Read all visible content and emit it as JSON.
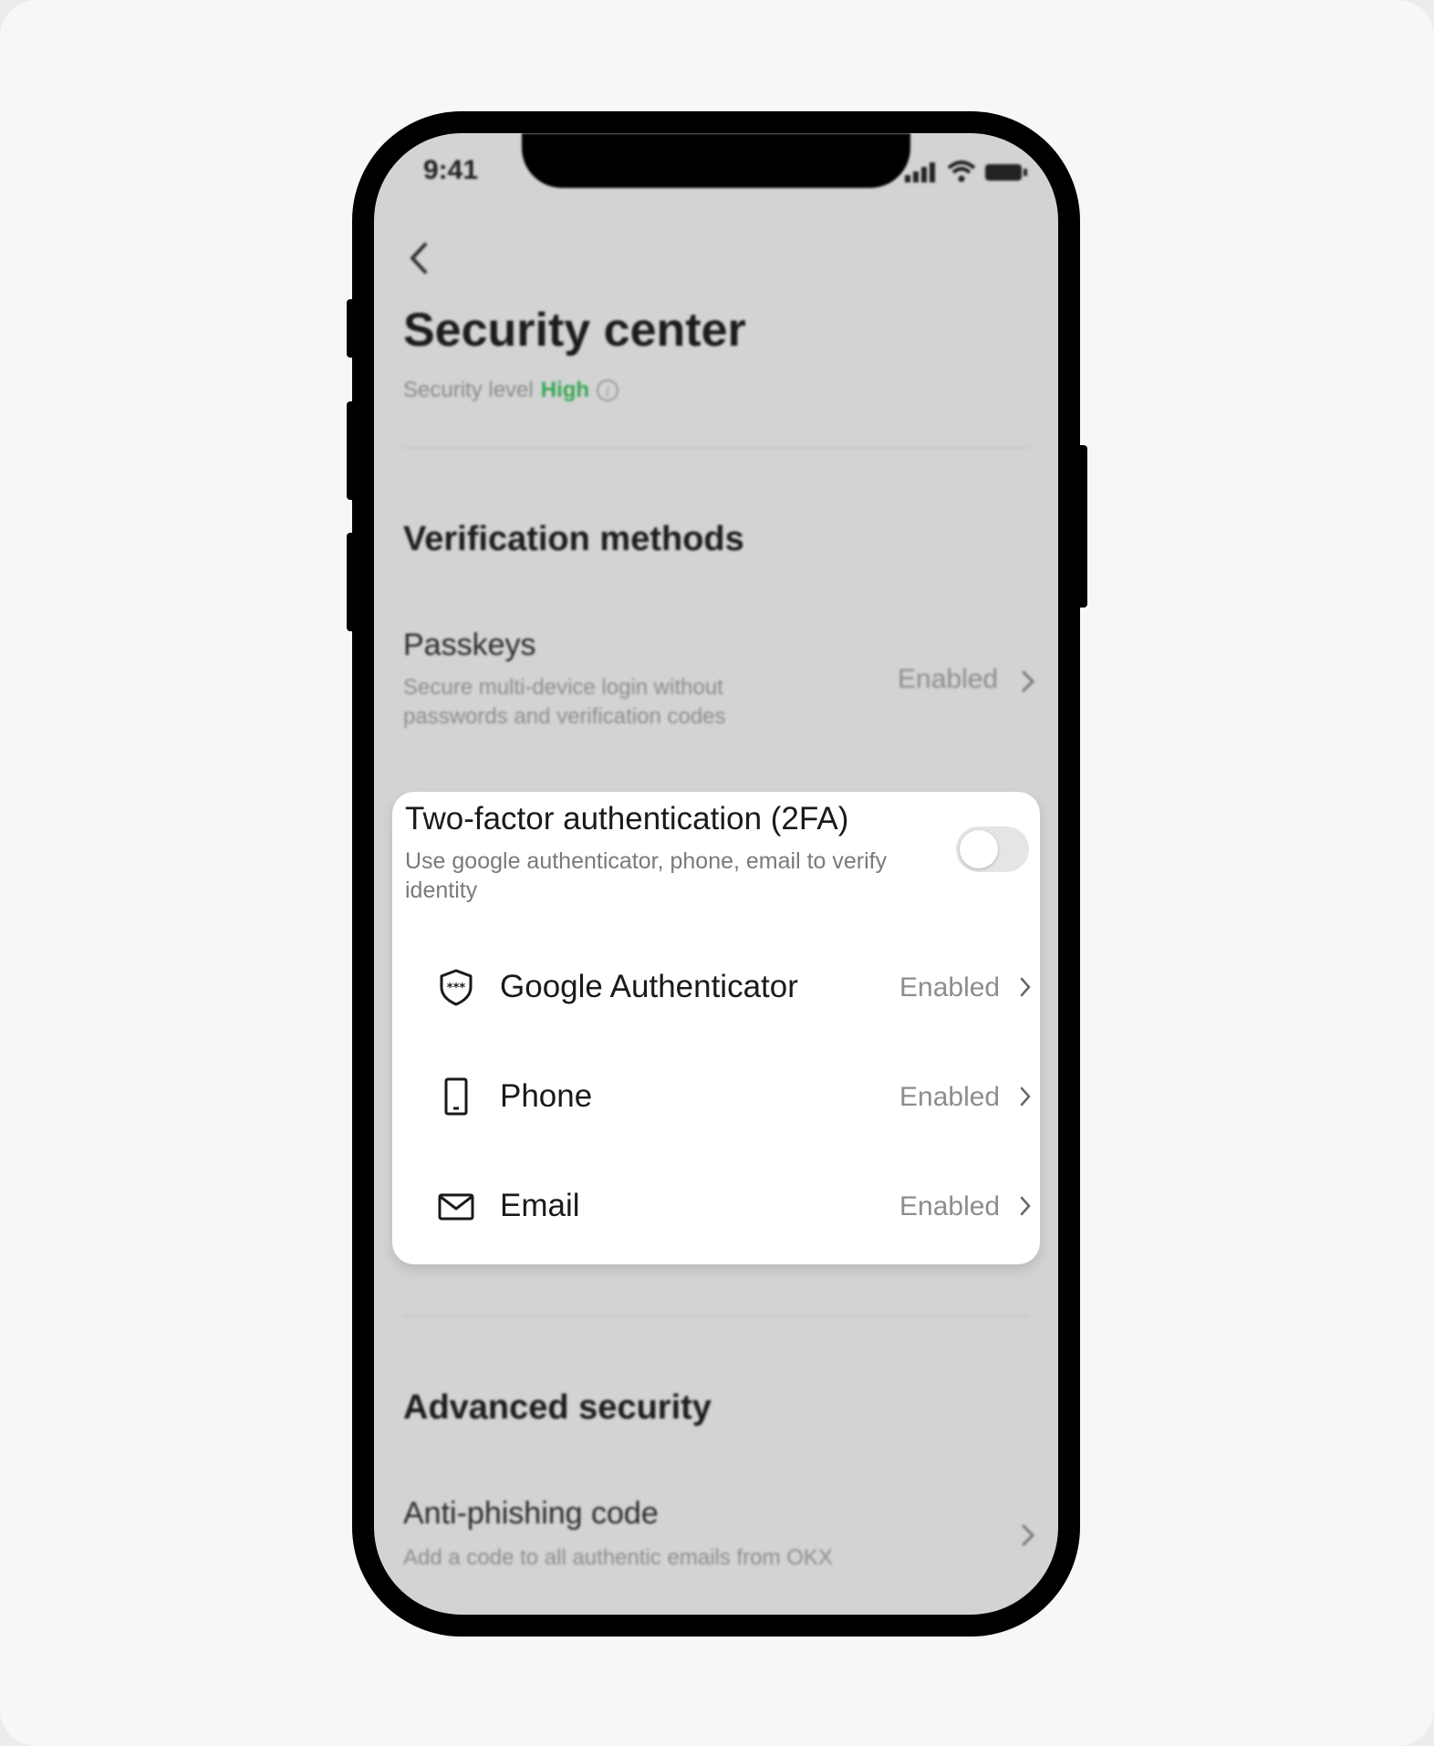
{
  "status_bar": {
    "time": "9:41"
  },
  "page": {
    "title": "Security center",
    "security_level_label": "Security level",
    "security_level_value": "High",
    "security_level_color": "#34a853"
  },
  "verification": {
    "heading": "Verification methods",
    "passkeys": {
      "title": "Passkeys",
      "description": "Secure multi-device login without passwords and verification codes",
      "status": "Enabled"
    },
    "two_factor": {
      "title": "Two-factor authentication (2FA)",
      "description": "Use google authenticator, phone, email to verify identity",
      "toggle_on": false,
      "methods": [
        {
          "label": "Google Authenticator",
          "status": "Enabled",
          "icon": "shield-icon"
        },
        {
          "label": "Phone",
          "status": "Enabled",
          "icon": "phone-icon"
        },
        {
          "label": "Email",
          "status": "Enabled",
          "icon": "mail-icon"
        }
      ]
    }
  },
  "advanced": {
    "heading": "Advanced security",
    "anti_phishing": {
      "title": "Anti-phishing code",
      "description": "Add a code to all authentic emails from OKX"
    }
  }
}
